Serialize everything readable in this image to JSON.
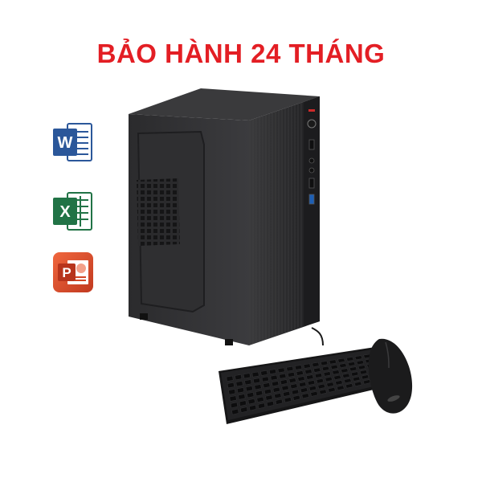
{
  "banner": {
    "headline": "BẢO HÀNH 24 THÁNG",
    "headline_color": "#e31e24"
  },
  "software_icons": [
    {
      "name": "word-icon",
      "letter": "W",
      "color": "#2b579a"
    },
    {
      "name": "excel-icon",
      "letter": "X",
      "color": "#217346"
    },
    {
      "name": "powerpoint-icon",
      "letter": "P",
      "color": "#d24726"
    }
  ],
  "product": {
    "items": [
      "pc-case",
      "keyboard",
      "mouse"
    ],
    "case_color": "#2a2a2c"
  }
}
